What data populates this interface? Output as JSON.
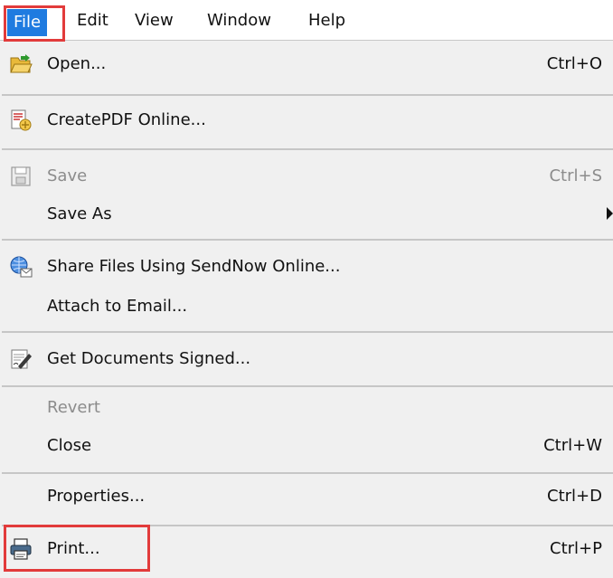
{
  "menubar": {
    "file": "File",
    "edit": "Edit",
    "view": "View",
    "window": "Window",
    "help": "Help"
  },
  "menu": {
    "open": {
      "label": "Open...",
      "shortcut": "Ctrl+O",
      "icon": "open-folder-icon"
    },
    "createpdf": {
      "label": "CreatePDF Online...",
      "icon": "create-pdf-icon"
    },
    "save": {
      "label": "Save",
      "shortcut": "Ctrl+S",
      "icon": "save-disk-icon"
    },
    "save_as": {
      "label": "Save As"
    },
    "share": {
      "label": "Share Files Using SendNow Online...",
      "icon": "share-globe-icon"
    },
    "attach": {
      "label": "Attach to Email..."
    },
    "signed": {
      "label": "Get Documents Signed...",
      "icon": "sign-document-icon"
    },
    "revert": {
      "label": "Revert"
    },
    "close": {
      "label": "Close",
      "shortcut": "Ctrl+W"
    },
    "properties": {
      "label": "Properties...",
      "shortcut": "Ctrl+D"
    },
    "print": {
      "label": "Print...",
      "shortcut": "Ctrl+P",
      "icon": "printer-icon"
    }
  },
  "colors": {
    "selected_menu_bg": "#1f7be0",
    "highlight_box": "#e23b3b",
    "disabled_text": "#8c8c8c"
  }
}
